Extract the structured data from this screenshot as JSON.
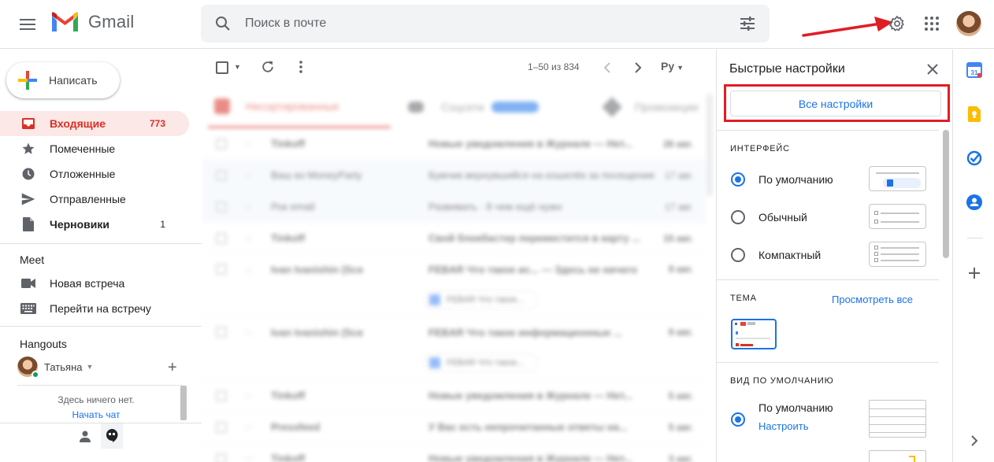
{
  "header": {
    "app_name": "Gmail",
    "search_placeholder": "Поиск в почте"
  },
  "sidebar": {
    "compose_label": "Написать",
    "items": [
      {
        "label": "Входящие",
        "count": "773",
        "icon": "inbox-icon"
      },
      {
        "label": "Помеченные",
        "count": "",
        "icon": "star-icon"
      },
      {
        "label": "Отложенные",
        "count": "",
        "icon": "clock-icon"
      },
      {
        "label": "Отправленные",
        "count": "",
        "icon": "send-icon"
      },
      {
        "label": "Черновики",
        "count": "1",
        "icon": "draft-icon"
      }
    ],
    "meet": {
      "title": "Meet",
      "new_meeting": "Новая встреча",
      "join_meeting": "Перейти на встречу"
    },
    "hangouts": {
      "title": "Hangouts",
      "user_name": "Татьяна",
      "empty_text": "Здесь ничего нет.",
      "start_chat": "Начать чат"
    }
  },
  "toolbar": {
    "page_range": "1–50 из 834",
    "lang": "Ру"
  },
  "blurred": {
    "tabs": [
      "Несортированные",
      "Соцсети",
      "Промоакции"
    ],
    "rows": [
      {
        "from": "Tinkoff",
        "subject": "Новые уведомления в Журнале — Нет...",
        "date": "26 авг."
      },
      {
        "from": "Ваш вз MoneyParty",
        "subject": "Бумчик вернувшийся на кошелёк за посещение",
        "date": "17 авг."
      },
      {
        "from": "Рок email",
        "subject": "Развивать · 8 чем ещё нужн",
        "date": "17 авг."
      },
      {
        "from": "Tinkoff",
        "subject": "Свой блокбастер переместится в карту ...",
        "date": "15 авг."
      },
      {
        "from": "Ivan Ivanishin (Sce",
        "subject": "FEBAR Что такое ис... — Здесь не ничего",
        "date": "9 авг."
      },
      {
        "from": "Ivan Ivanishin (Sce",
        "subject": "FEBAR Что такое информационные ...",
        "date": "9 авг."
      },
      {
        "from": "Tinkoff",
        "subject": "Новые уведомления в Журнале — Нет...",
        "date": "5 авг."
      },
      {
        "from": "Pressfeed",
        "subject": "У Вас есть непрочитанные ответы на...",
        "date": "5 авг."
      },
      {
        "from": "Tinkoff",
        "subject": "Новые уведомления в Журнале — Нет...",
        "date": "3 авг."
      }
    ],
    "attachment": "FEBAR Что такое..."
  },
  "quick_settings": {
    "title": "Быстрые настройки",
    "all_settings": "Все настройки",
    "density_title": "ИНТЕРФЕЙС",
    "density_options": [
      "По умолчанию",
      "Обычный",
      "Компактный"
    ],
    "theme_title": "ТЕМА",
    "theme_view_all": "Просмотреть все",
    "inbox_type_title": "ВИД ПО УМОЛЧАНИЮ",
    "inbox_default": "По умолчанию",
    "inbox_customize": "Настроить"
  },
  "colors": {
    "accent_red": "#d93025",
    "link_blue": "#1a73e8",
    "highlight": "#e11d24"
  }
}
